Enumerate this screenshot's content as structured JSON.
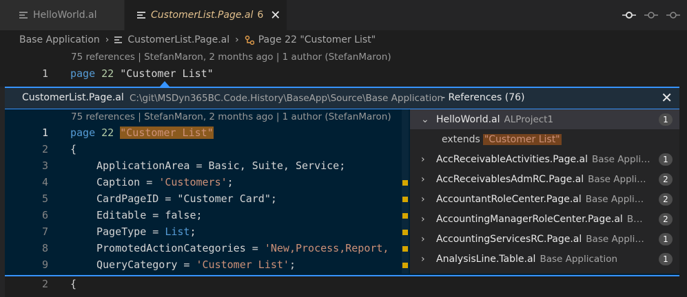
{
  "tabs": [
    {
      "label": "HelloWorld.al",
      "icon": "lines-icon"
    },
    {
      "label": "CustomerList.Page.al",
      "count": "6",
      "close": "✕",
      "icon": "lines-icon"
    }
  ],
  "breadcrumb": {
    "part1": "Base Application",
    "part2": "CustomerList.Page.al",
    "part3": "Page 22 \"Customer List\""
  },
  "codelens": "75 references | StefanMaron, 2 months ago | 1 author (StefanMaron)",
  "top_line": {
    "num": "1",
    "kw": "page",
    "n": "22",
    "str": "\"Customer List\""
  },
  "peek": {
    "file": "CustomerList.Page.al",
    "path": "C:\\git\\MSDyn365BC.Code.History\\BaseApp\\Source\\Base Application",
    "refs_title": "- References (76)",
    "close": "✕",
    "codelens": "75 references | StefanMaron, 2 months ago | 1 author (StefanMaron)",
    "lines": [
      {
        "n": "1"
      },
      {
        "n": "2"
      },
      {
        "n": "3"
      },
      {
        "n": "4"
      },
      {
        "n": "5"
      },
      {
        "n": "6"
      },
      {
        "n": "7"
      },
      {
        "n": "8"
      },
      {
        "n": "9"
      }
    ],
    "code": {
      "l1a": "page",
      "l1b": "22",
      "l1c": "\"Customer List\"",
      "l2": "{",
      "l3": "ApplicationArea = Basic, Suite, Service;",
      "l4a": "Caption = ",
      "l4b": "'Customers'",
      "l4c": ";",
      "l5": "CardPageID = \"Customer Card\";",
      "l6": "Editable = false;",
      "l7a": "PageType = ",
      "l7b": "List",
      "l7c": ";",
      "l8a": "PromotedActionCategories = ",
      "l8b": "'New,Process,Report,",
      "l9a": "QueryCategory = ",
      "l9b": "'Customer List'",
      "l9c": ";"
    },
    "tree": [
      {
        "file": "HelloWorld.al",
        "dir": "ALProject1",
        "count": "1",
        "chev": "⌄"
      },
      {
        "ext": "extends",
        "match": "\"Customer List\""
      },
      {
        "file": "AccReceivableActivities.Page.al",
        "dir": "Base Applic...",
        "count": "1",
        "chev": "›"
      },
      {
        "file": "AccReceivablesAdmRC.Page.al",
        "dir": "Base Applic...",
        "count": "2",
        "chev": "›"
      },
      {
        "file": "AccountantRoleCenter.Page.al",
        "dir": "Base Applica...",
        "count": "2",
        "chev": "›"
      },
      {
        "file": "AccountingManagerRoleCenter.Page.al",
        "dir": "Ba...",
        "count": "2",
        "chev": "›"
      },
      {
        "file": "AccountingServicesRC.Page.al",
        "dir": "Base Applica...",
        "count": "1",
        "chev": "›"
      },
      {
        "file": "AnalysisLine.Table.al",
        "dir": "Base Application",
        "count": "1",
        "chev": "›"
      }
    ]
  },
  "bottom_line": {
    "num": "2",
    "text": "{"
  },
  "colors": {
    "accent": "#3794ff",
    "modified": "#e2c08d",
    "highlight": "#8b5a1e"
  }
}
